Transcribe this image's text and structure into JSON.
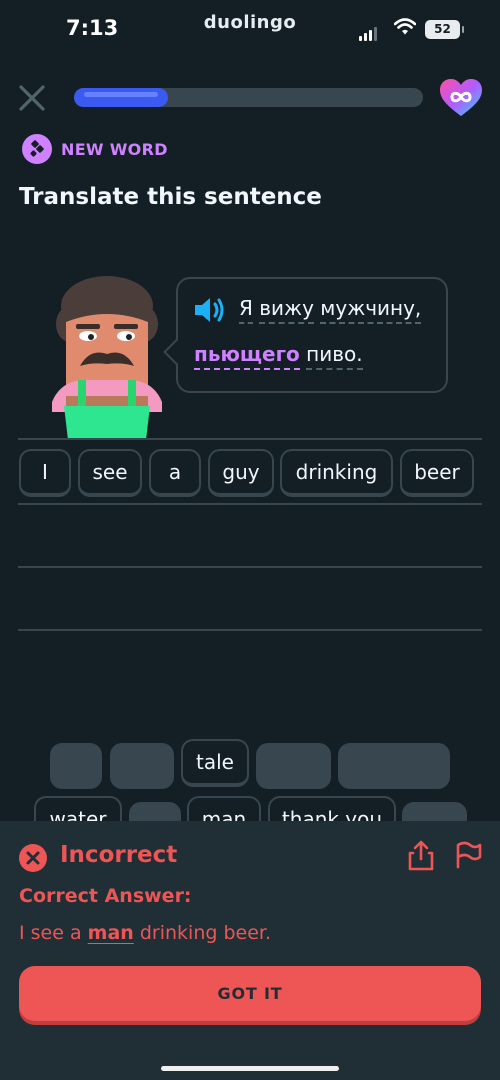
{
  "status_bar": {
    "time": "7:13",
    "brand": "duolingo",
    "battery": "52"
  },
  "progress": {
    "fraction": 0.27
  },
  "header": {
    "badge": "NEW WORD",
    "instruction": "Translate this sentence"
  },
  "prompt": {
    "line1": [
      "Я",
      "вижу",
      "мужчину,"
    ],
    "line2_highlight": "пьющего",
    "line2_rest": "пиво."
  },
  "answer_tiles": [
    "I",
    "see",
    "a",
    "guy",
    "drinking",
    "beer"
  ],
  "word_bank": {
    "row1": [
      "",
      "",
      "tale",
      "",
      ""
    ],
    "row2": [
      "water",
      "",
      "man",
      "thank you",
      ""
    ]
  },
  "feedback": {
    "status": "Incorrect",
    "correct_answer_label": "Correct Answer:",
    "answer_before": "I see a ",
    "answer_highlight": "man",
    "answer_after": " drinking beer.",
    "button": "GOT IT"
  },
  "colors": {
    "background": "#141f25",
    "accent_purple": "#ce82ff",
    "progress_blue": "#3b5af1",
    "error_red": "#ee5555",
    "panel": "#202f36"
  },
  "icons": [
    "close-icon",
    "heart-infinity-icon",
    "new-word-icon",
    "speaker-icon",
    "incorrect-x-icon",
    "share-icon",
    "flag-icon"
  ]
}
